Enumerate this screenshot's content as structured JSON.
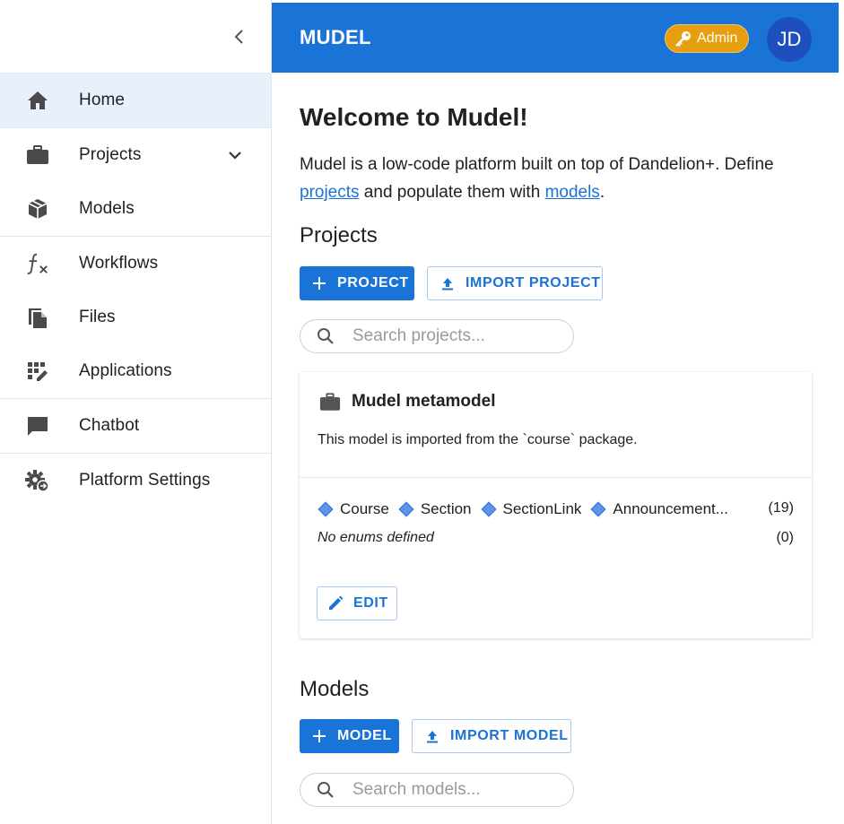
{
  "sidebar": {
    "items": [
      {
        "label": "Home",
        "icon": "home-icon",
        "active": true
      },
      {
        "label": "Projects",
        "icon": "briefcase-icon",
        "expandable": true
      },
      {
        "label": "Models",
        "icon": "cube-icon"
      },
      {
        "label": "Workflows",
        "icon": "function-icon"
      },
      {
        "label": "Files",
        "icon": "file-copy-icon"
      },
      {
        "label": "Applications",
        "icon": "apps-edit-icon"
      },
      {
        "label": "Chatbot",
        "icon": "chat-icon"
      },
      {
        "label": "Platform Settings",
        "icon": "settings-cog-icon"
      }
    ]
  },
  "header": {
    "brand": "MUDEL",
    "admin_label": "Admin",
    "avatar_initials": "JD"
  },
  "main": {
    "welcome_title": "Welcome to Mudel!",
    "intro": {
      "part1": "Mudel is a low-code platform built on top of Dandelion+. Define ",
      "link1": "projects",
      "part2": " and populate them with ",
      "link2": "models",
      "part3": "."
    },
    "projects": {
      "title": "Projects",
      "add_button": "PROJECT",
      "import_button": "IMPORT PROJECT",
      "search_placeholder": "Search projects..."
    },
    "project_card": {
      "title": "Mudel metamodel",
      "description": "This model is imported from the `course` package.",
      "types": [
        "Course",
        "Section",
        "SectionLink",
        "Announcement..."
      ],
      "types_count": "(19)",
      "enums_text": "No enums defined",
      "enums_count": "(0)",
      "edit_button": "EDIT"
    },
    "models": {
      "title": "Models",
      "add_button": "MODEL",
      "import_button": "IMPORT MODEL",
      "search_placeholder": "Search models..."
    }
  },
  "colors": {
    "primary": "#1a73d6",
    "admin_chip": "#e89f0f",
    "avatar": "#1e4fbf",
    "active_nav": "#e8f1fb"
  }
}
